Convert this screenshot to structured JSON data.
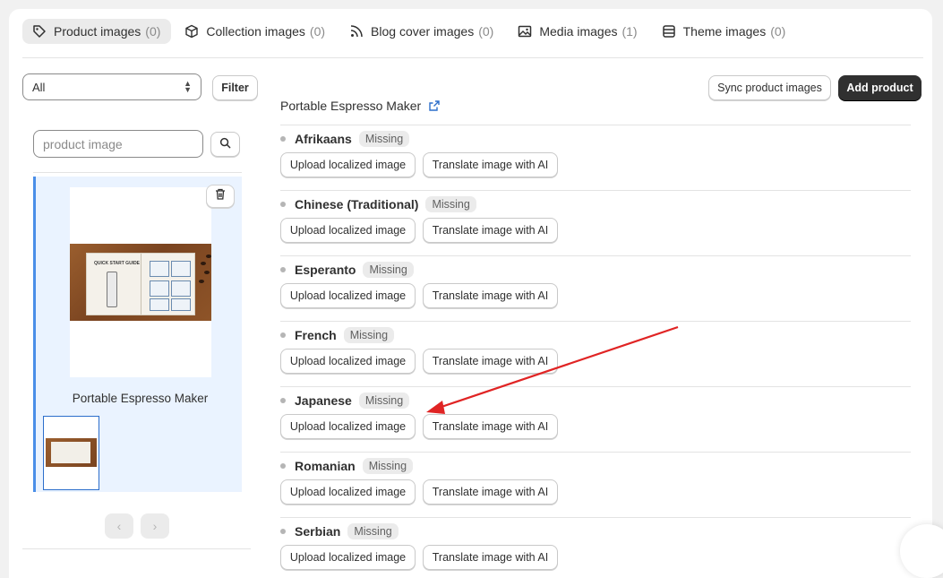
{
  "tabs": [
    {
      "label": "Product images",
      "count": "(0)",
      "icon": "tag-icon",
      "active": true
    },
    {
      "label": "Collection images",
      "count": "(0)",
      "icon": "cube-icon",
      "active": false
    },
    {
      "label": "Blog cover images",
      "count": "(0)",
      "icon": "rss-icon",
      "active": false
    },
    {
      "label": "Media images",
      "count": "(1)",
      "icon": "image-icon",
      "active": false
    },
    {
      "label": "Theme images",
      "count": "(0)",
      "icon": "theme-icon",
      "active": false
    }
  ],
  "filter": {
    "select_value": "All",
    "filter_label": "Filter"
  },
  "search": {
    "placeholder": "product image"
  },
  "selected_product": {
    "caption": "Portable Espresso Maker",
    "book_title": "QUICK START GUIDE"
  },
  "toolbar": {
    "sync_label": "Sync product images",
    "add_label": "Add product"
  },
  "product": {
    "title": "Portable Espresso Maker"
  },
  "row_actions": {
    "upload_label": "Upload localized image",
    "translate_label": "Translate image with AI"
  },
  "languages": [
    {
      "name": "Afrikaans",
      "status": "Missing"
    },
    {
      "name": "Chinese (Traditional)",
      "status": "Missing"
    },
    {
      "name": "Esperanto",
      "status": "Missing"
    },
    {
      "name": "French",
      "status": "Missing"
    },
    {
      "name": "Japanese",
      "status": "Missing"
    },
    {
      "name": "Romanian",
      "status": "Missing"
    },
    {
      "name": "Serbian",
      "status": "Missing"
    }
  ],
  "colors": {
    "accent_selected": "#4a8ee8",
    "primary_button": "#303030",
    "annotation_arrow": "#e02424"
  }
}
